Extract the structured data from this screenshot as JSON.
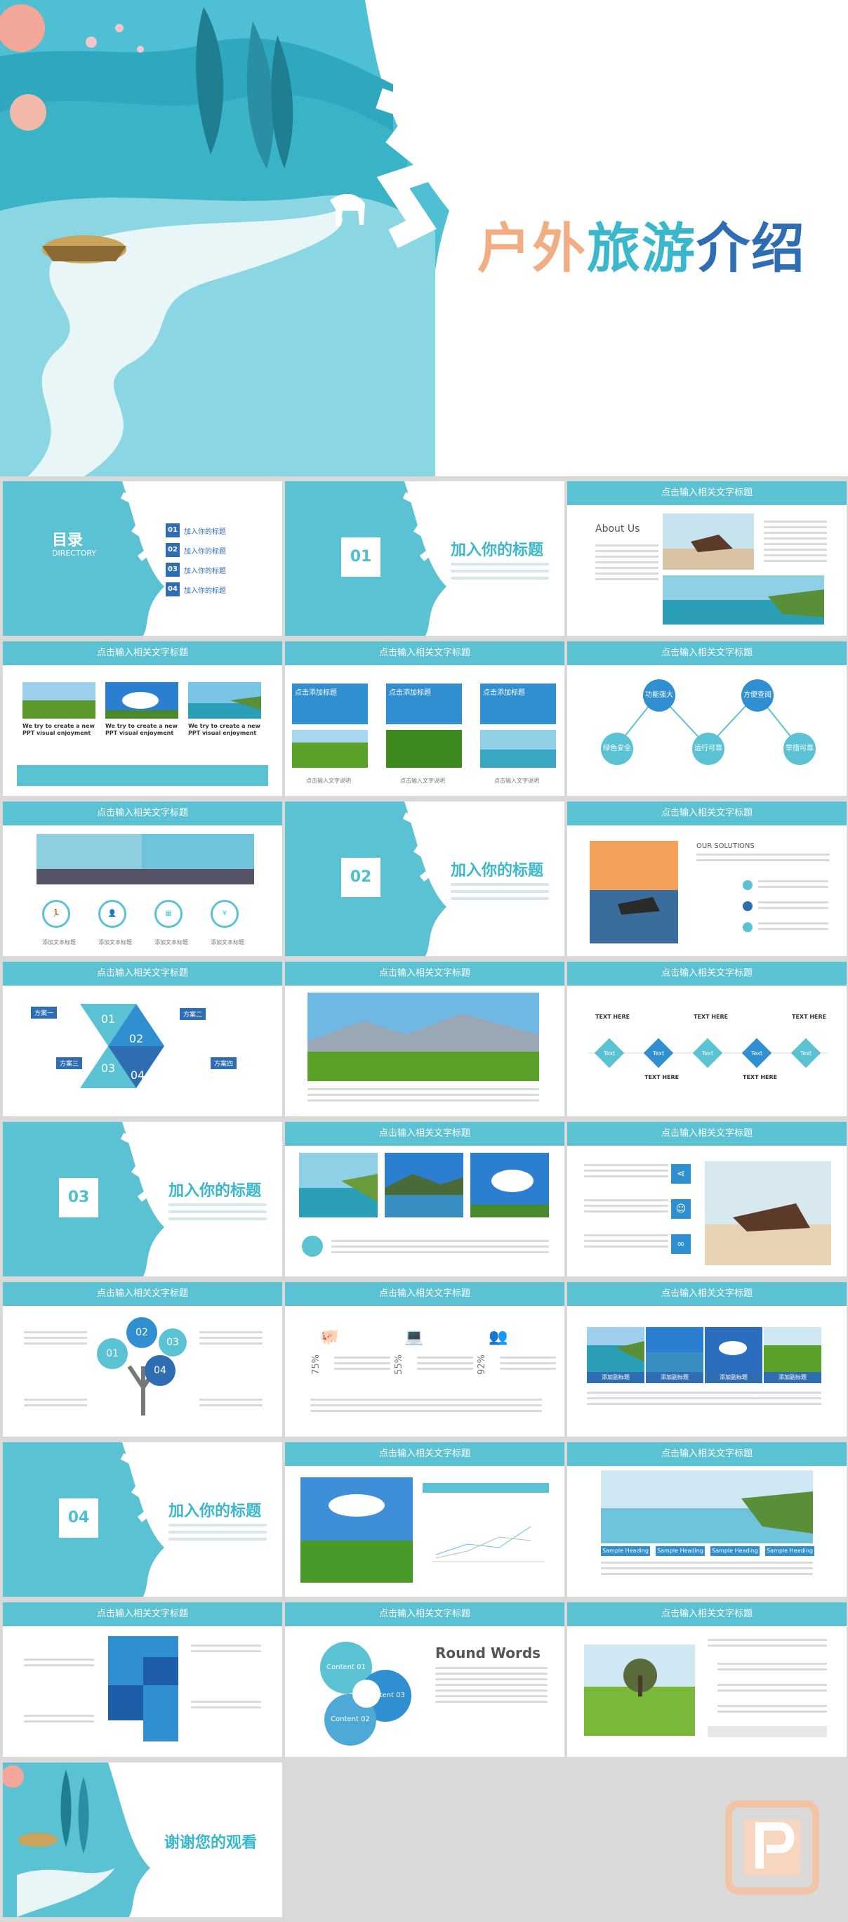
{
  "cover": {
    "title_part1": "户外",
    "title_part2": "旅游",
    "title_part3": "介绍"
  },
  "toc": {
    "title": "目录",
    "subtitle": "DIRECTORY",
    "items": [
      {
        "num": "01",
        "label": "加入你的标题"
      },
      {
        "num": "02",
        "label": "加入你的标题"
      },
      {
        "num": "03",
        "label": "加入你的标题"
      },
      {
        "num": "04",
        "label": "加入你的标题"
      }
    ]
  },
  "sections": [
    {
      "num": "01",
      "title": "加入你的标题"
    },
    {
      "num": "02",
      "title": "加入你的标题"
    },
    {
      "num": "03",
      "title": "加入你的标题"
    },
    {
      "num": "04",
      "title": "加入你的标题"
    }
  ],
  "slide_header": "点击输入相关文字标题",
  "about": {
    "title": "About Us"
  },
  "s_photos3": {
    "captions": [
      "We try to create a new PPT visual enjoyment",
      "We try to create a new PPT visual enjoyment",
      "We try to create a new PPT visual enjoyment"
    ]
  },
  "s_blue3": {
    "labels": [
      "点击添加标题",
      "点击添加标题",
      "点击添加标题"
    ],
    "captions": [
      "点击输入文字说明",
      "点击输入文字说明",
      "点击输入文字说明"
    ]
  },
  "s_circles": {
    "items": [
      "功能强大",
      "方便查阅",
      "绿色安全",
      "运行可靠",
      "举措可靠"
    ]
  },
  "s_icons": {
    "labels": [
      "添加文本标题",
      "添加文本标题",
      "添加文本标题",
      "添加文本标题"
    ]
  },
  "s_solutions": {
    "title": "SOLUTIONS",
    "prefix": "OUR"
  },
  "s_tri": {
    "labels": [
      "方案一",
      "方案二",
      "方案三",
      "方案四"
    ],
    "nums": [
      "01",
      "02",
      "03",
      "04"
    ]
  },
  "s_diamonds": {
    "labels": [
      "Text",
      "Text",
      "Text",
      "Text",
      "Text"
    ],
    "heads": [
      "TEXT HERE",
      "TEXT HERE",
      "TEXT HERE",
      "TEXT HERE",
      "TEXT HERE"
    ]
  },
  "s_tree": {
    "nums": [
      "01",
      "02",
      "03",
      "04"
    ]
  },
  "s_percent": {
    "values": [
      "75%",
      "55%",
      "92%"
    ]
  },
  "s_4photos": {
    "labels": [
      "添加副标题",
      "添加副标题",
      "添加副标题",
      "添加副标题"
    ]
  },
  "s_sample": {
    "labels": [
      "Sample Heading",
      "Sample Heading",
      "Sample Heading",
      "Sample Heading"
    ]
  },
  "s_round": {
    "title": "Round Words",
    "labels": [
      "Content 01",
      "Content 02",
      "Content 03"
    ]
  },
  "thanks": {
    "text": "谢谢您的观看"
  },
  "colors": {
    "teal": "#5bc2d4",
    "blue": "#2f6db3",
    "peach": "#f2ae82"
  }
}
